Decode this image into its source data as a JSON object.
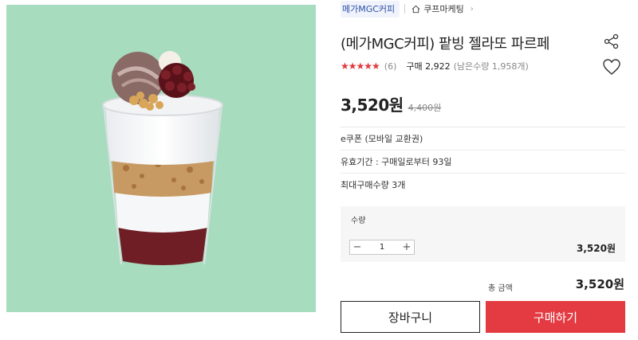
{
  "breadcrumb": {
    "brand": "메가MGC커피",
    "category": "쿠프마케팅"
  },
  "product": {
    "title": "(메가MGC커피) 팥빙 젤라또 파르페",
    "stars": "★★★★★",
    "rating_value": 5,
    "review_count": "(6)",
    "purchase_count": "구매 2,922",
    "remaining": "(남은수량 1,958개)",
    "price": "3,520원",
    "original_price": "4,400원"
  },
  "details": {
    "type": "e쿠폰 (모바일 교환권)",
    "validity": "유효기간 : 구매일로부터 93일",
    "max_purchase": "최대구매수량 3개"
  },
  "quantity": {
    "label": "수량",
    "minus": "−",
    "value": "1",
    "plus": "+",
    "subtotal": "3,520원"
  },
  "total": {
    "label": "총 금액",
    "value": "3,520원"
  },
  "buttons": {
    "cart": "장바구니",
    "buy": "구매하기"
  },
  "colors": {
    "image_background": "#a8dcbe",
    "buy_button": "#e43b43",
    "star": "#e0393e",
    "brand_link": "#2a4fa8"
  },
  "icons": {
    "share": "share-icon",
    "wishlist": "heart-icon",
    "home": "home-icon",
    "breadcrumb_arrow": "chevron-right-icon"
  }
}
